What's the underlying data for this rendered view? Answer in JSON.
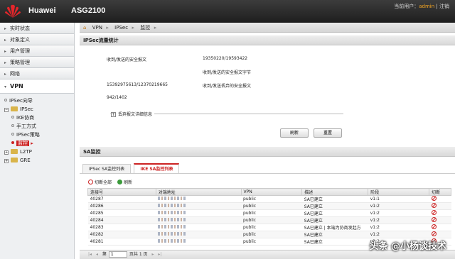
{
  "header": {
    "brand": "Huawei",
    "model": "ASG2100",
    "user_label": "当前用户：",
    "user_name": "admin",
    "logout": "| 注销"
  },
  "sidebar": {
    "items": [
      {
        "label": "实时状态"
      },
      {
        "label": "对象定义"
      },
      {
        "label": "用户管理"
      },
      {
        "label": "策略管理"
      },
      {
        "label": "网络"
      }
    ],
    "active": "VPN",
    "tree": {
      "ipsec_wizard": "IPSec向导",
      "ipsec": "IPSec",
      "ike": "IKE协商",
      "manual": "手工方式",
      "policy": "IPSec策略",
      "monitor": "监控",
      "l2tp": "L2TP",
      "gre": "GRE"
    }
  },
  "breadcrumb": {
    "vpn": "VPN",
    "ipsec": "IPSec",
    "monitor": "监控"
  },
  "traffic": {
    "title": "IPSec流量统计",
    "recv_sent_label": "收到/发送的安全报文",
    "recv_sent_value": "19350220/19593422",
    "bytes_label": "收到/发送的安全报文字节",
    "bytes_value": "15392975613/12370219665",
    "dropped_label": "收到/发送丢弃的安全报文",
    "dropped_value": "942/1402",
    "detail_toggle": "丢弃报文详细信息",
    "refresh": "刷新",
    "reset": "重置"
  },
  "sa": {
    "title": "SA监控",
    "tabs": [
      "IPSec SA监控列表",
      "IKE SA监控列表"
    ],
    "cut_all": "切断全部",
    "refresh": "刷新",
    "columns": [
      "连接号",
      "对端地址",
      "VPN",
      "描述",
      "阶段",
      "切断"
    ],
    "rows": [
      {
        "id": "40287",
        "vpn": "public",
        "desc": "SA已建立",
        "phase": "v1:1"
      },
      {
        "id": "40286",
        "vpn": "public",
        "desc": "SA已建立",
        "phase": "v1:2"
      },
      {
        "id": "40285",
        "vpn": "public",
        "desc": "SA已建立",
        "phase": "v1:2"
      },
      {
        "id": "40284",
        "vpn": "public",
        "desc": "SA已建立",
        "phase": "v1:2"
      },
      {
        "id": "40283",
        "vpn": "public",
        "desc": "SA已建立 | 本端为协商发起方",
        "phase": "v1:2"
      },
      {
        "id": "40282",
        "vpn": "public",
        "desc": "SA已建立",
        "phase": "v1:2"
      },
      {
        "id": "40281",
        "vpn": "public",
        "desc": "SA已建立",
        "phase": "v1:2"
      }
    ]
  },
  "pager": {
    "prefix": "第",
    "page": "1",
    "suffix": "页共 1 页"
  },
  "watermark": "头条 @小杨谈技术"
}
